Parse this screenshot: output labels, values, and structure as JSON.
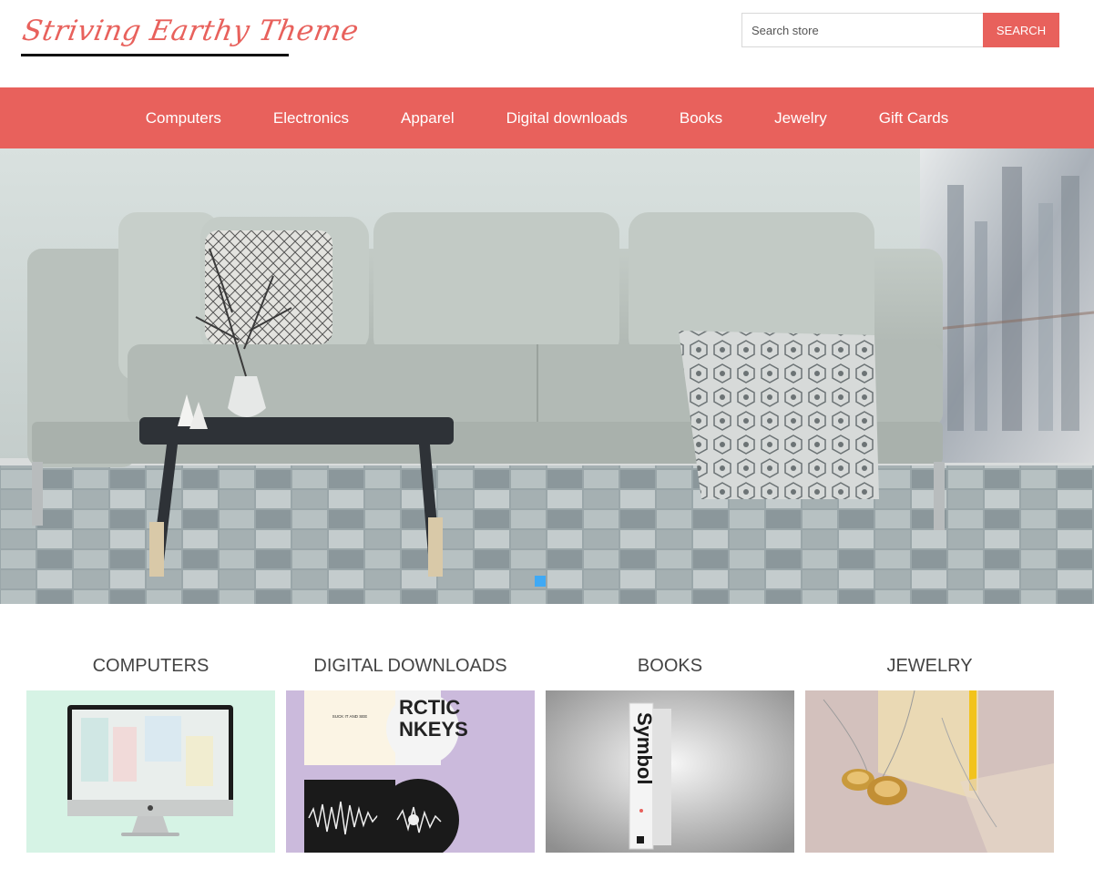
{
  "header": {
    "logo_text": "Striving Earthy Theme",
    "search": {
      "placeholder": "Search store",
      "button_label": "SEARCH"
    }
  },
  "nav": {
    "items": [
      {
        "label": "Computers"
      },
      {
        "label": "Electronics"
      },
      {
        "label": "Apparel"
      },
      {
        "label": "Digital downloads"
      },
      {
        "label": "Books"
      },
      {
        "label": "Jewelry"
      },
      {
        "label": "Gift Cards"
      }
    ]
  },
  "slider": {
    "image_description": "living-room-sofa",
    "dot_count": 1,
    "active_dot": 1
  },
  "categories": [
    {
      "title": "COMPUTERS"
    },
    {
      "title": "DIGITAL DOWNLOADS"
    },
    {
      "title": "BOOKS",
      "image_text": "Symbol"
    },
    {
      "title": "JEWELRY"
    }
  ],
  "album_text": {
    "top_left": "SUCK IT AND SEE",
    "top_right": "RCTIC\nNKEYS"
  },
  "colors": {
    "accent": "#e8615c",
    "slider_dot": "#3fa9f5",
    "text": "#444444"
  }
}
